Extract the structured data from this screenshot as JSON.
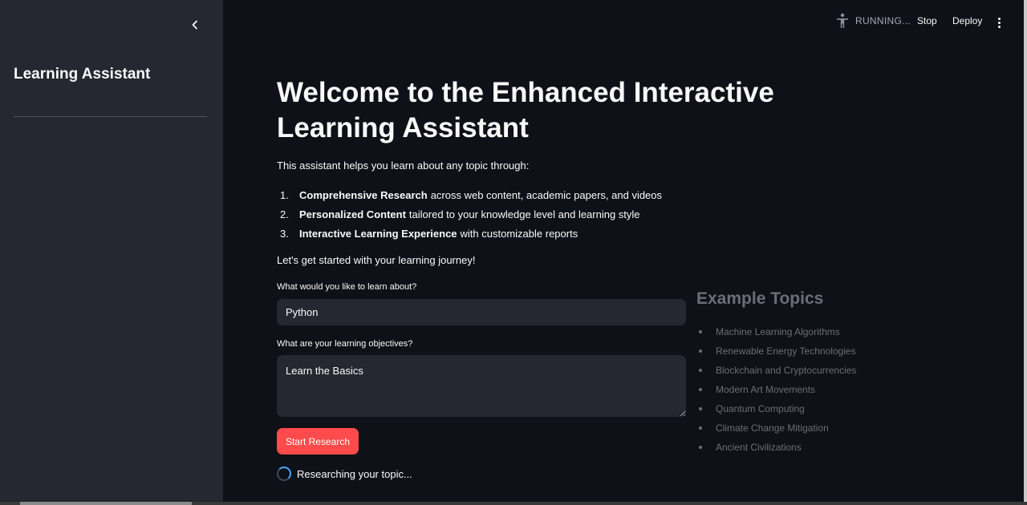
{
  "sidebar": {
    "title": "Learning Assistant",
    "collapse_icon": "chevron-left-icon"
  },
  "header": {
    "status_icon": "running-person-icon",
    "status_text": "RUNNING...",
    "stop_label": "Stop",
    "deploy_label": "Deploy",
    "menu_icon": "vertical-dots-icon"
  },
  "main": {
    "title": "Welcome to the Enhanced Interactive Learning Assistant",
    "intro": "This assistant helps you learn about any topic through:",
    "features": [
      {
        "num": "1.",
        "bold": "Comprehensive Research",
        "rest": "across web content, academic papers, and videos"
      },
      {
        "num": "2.",
        "bold": "Personalized Content",
        "rest": "tailored to your knowledge level and learning style"
      },
      {
        "num": "3.",
        "bold": "Interactive Learning Experience",
        "rest": "with customizable reports"
      }
    ],
    "lets_go": "Let's get started with your learning journey!",
    "topic_label": "What would you like to learn about?",
    "topic_value": "Python",
    "objectives_label": "What are your learning objectives?",
    "objectives_value": "Learn the Basics",
    "start_button": "Start Research",
    "status_message": "Researching your topic..."
  },
  "examples": {
    "title": "Example Topics",
    "items": [
      "Machine Learning Algorithms",
      "Renewable Energy Technologies",
      "Blockchain and Cryptocurrencies",
      "Modern Art Movements",
      "Quantum Computing",
      "Climate Change Mitigation",
      "Ancient Civilizations"
    ]
  },
  "colors": {
    "background": "#0e1117",
    "sidebar": "#262730",
    "accent": "#ff4b4b",
    "muted_text": "#6b6e76"
  }
}
